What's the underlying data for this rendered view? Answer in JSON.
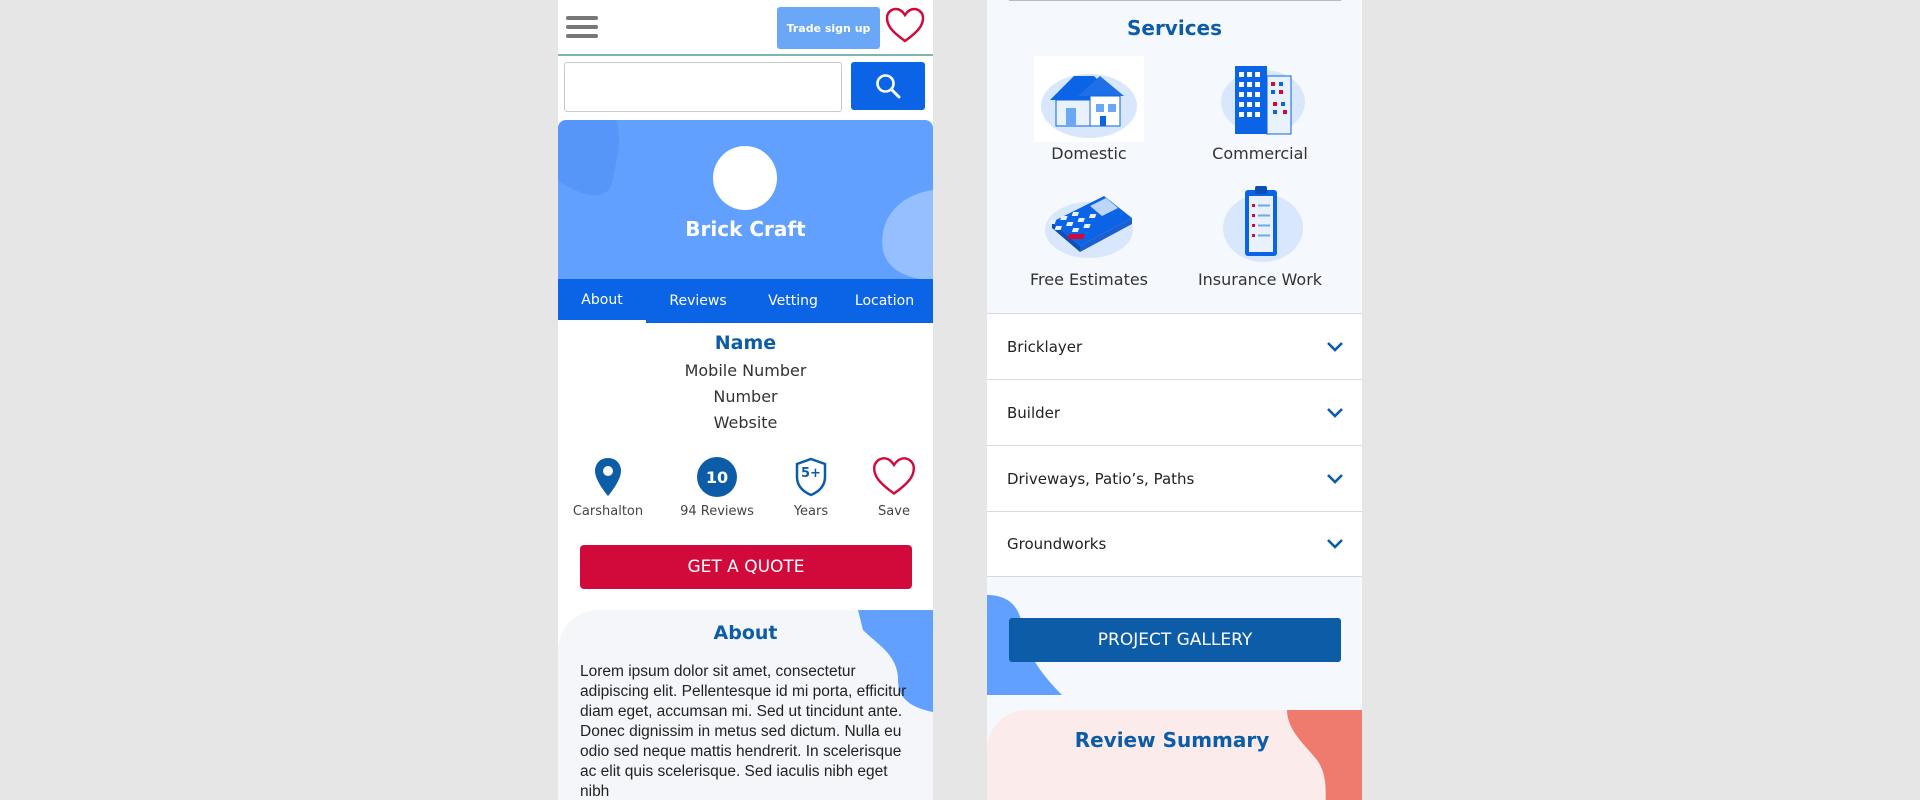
{
  "header": {
    "trade_signup_label": "Trade sign up"
  },
  "search": {
    "value": "",
    "placeholder": ""
  },
  "profile": {
    "company_name": "Brick Craft"
  },
  "tabs": [
    {
      "label": "About"
    },
    {
      "label": "Reviews"
    },
    {
      "label": "Vetting"
    },
    {
      "label": "Location"
    }
  ],
  "contact": {
    "name_label": "Name",
    "mobile_label": "Mobile Number",
    "number_label": "Number",
    "website_label": "Website"
  },
  "stats": {
    "location_label": "Carshalton",
    "reviews_badge": "10",
    "reviews_label": "94 Reviews",
    "years_badge": "5+",
    "years_label": "Years",
    "save_label": "Save"
  },
  "quote_button_label": "GET A QUOTE",
  "about": {
    "title": "About",
    "text": "Lorem ipsum dolor sit amet, consectetur adipiscing elit. Pellentesque id mi porta, efficitur diam eget, accumsan mi. Sed ut tincidunt ante. Donec dignissim in metus sed dictum. Nulla eu odio sed neque mattis hendrerit. In scelerisque ac elit quis scelerisque. Sed iaculis nibh eget nibh"
  },
  "services": {
    "title": "Services",
    "items": [
      {
        "label": "Domestic",
        "icon": "house-icon"
      },
      {
        "label": "Commercial",
        "icon": "office-building-icon"
      },
      {
        "label": "Free Estimates",
        "icon": "calculator-icon"
      },
      {
        "label": "Insurance Work",
        "icon": "clipboard-icon"
      }
    ]
  },
  "accordion": [
    {
      "label": "Bricklayer"
    },
    {
      "label": "Builder"
    },
    {
      "label": "Driveways, Patio’s, Paths"
    },
    {
      "label": "Groundworks"
    }
  ],
  "gallery_button_label": "PROJECT GALLERY",
  "review_summary_title": "Review Summary",
  "colors": {
    "primary_blue": "#0b63e5",
    "dark_blue": "#0d5ca8",
    "light_blue": "#62a0ff",
    "accent_red": "#d20a3c",
    "coral": "#ef7a6e"
  }
}
